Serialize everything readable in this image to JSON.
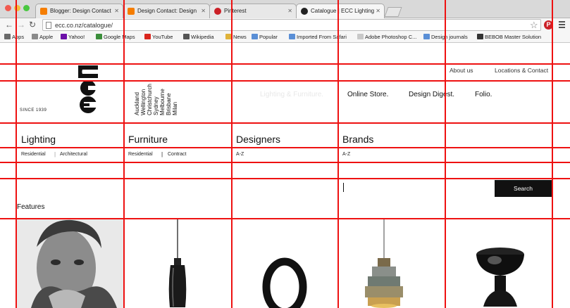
{
  "browser": {
    "tabs": [
      {
        "title": "Blogger: Design Contact",
        "favicon_color": "#f57d00",
        "active": false
      },
      {
        "title": "Design Contact: Design",
        "favicon_color": "#f57d00",
        "active": false
      },
      {
        "title": "Pinterest",
        "favicon_color": "#cb2027",
        "active": false
      },
      {
        "title": "Catalogue | ECC Lighting",
        "favicon_color": "#222222",
        "active": true
      }
    ],
    "url": "ecc.co.nz/catalogue/",
    "bookmarks": [
      {
        "label": "Apps",
        "color": "#6a6a6a"
      },
      {
        "label": "Apple",
        "color": "#8a8a8a"
      },
      {
        "label": "Yahoo!",
        "color": "#6b0fa8"
      },
      {
        "label": "Google Maps",
        "color": "#3b8e3b"
      },
      {
        "label": "YouTube",
        "color": "#d9251d"
      },
      {
        "label": "Wikipedia",
        "color": "#555555"
      },
      {
        "label": "News",
        "color": "#e0b33a"
      },
      {
        "label": "Popular",
        "color": "#5a8fd6"
      },
      {
        "label": "Imported From Safari",
        "color": "#5a8fd6"
      },
      {
        "label": "Adobe Photoshop C...",
        "color": "#c8c8c8"
      },
      {
        "label": "Design journals",
        "color": "#5a8fd6"
      },
      {
        "label": "BEBOB Master Solution",
        "color": "#333333"
      }
    ]
  },
  "site": {
    "since": "SINCE 1939",
    "cities": "Auckland\nWellington\nChristchurch\nSydney\nMelbourne\nBrisbane\nMilan",
    "utility_links": [
      "About us",
      "Locations & Contact"
    ],
    "main_nav": [
      "Lighting & Furniture.",
      "Online Store.",
      "Design Digest.",
      "Folio."
    ],
    "categories": [
      {
        "title": "Lighting",
        "links": [
          "Residential",
          "Architectural"
        ]
      },
      {
        "title": "Furniture",
        "links": [
          "Residential",
          "Contract"
        ]
      },
      {
        "title": "Designers",
        "links": [
          "A-Z"
        ]
      },
      {
        "title": "Brands",
        "links": [
          "A-Z"
        ]
      }
    ],
    "search_button": "Search",
    "features_heading": "Features"
  },
  "colors": {
    "grid_overlay": "#ee1111",
    "accent_dark": "#111111"
  }
}
